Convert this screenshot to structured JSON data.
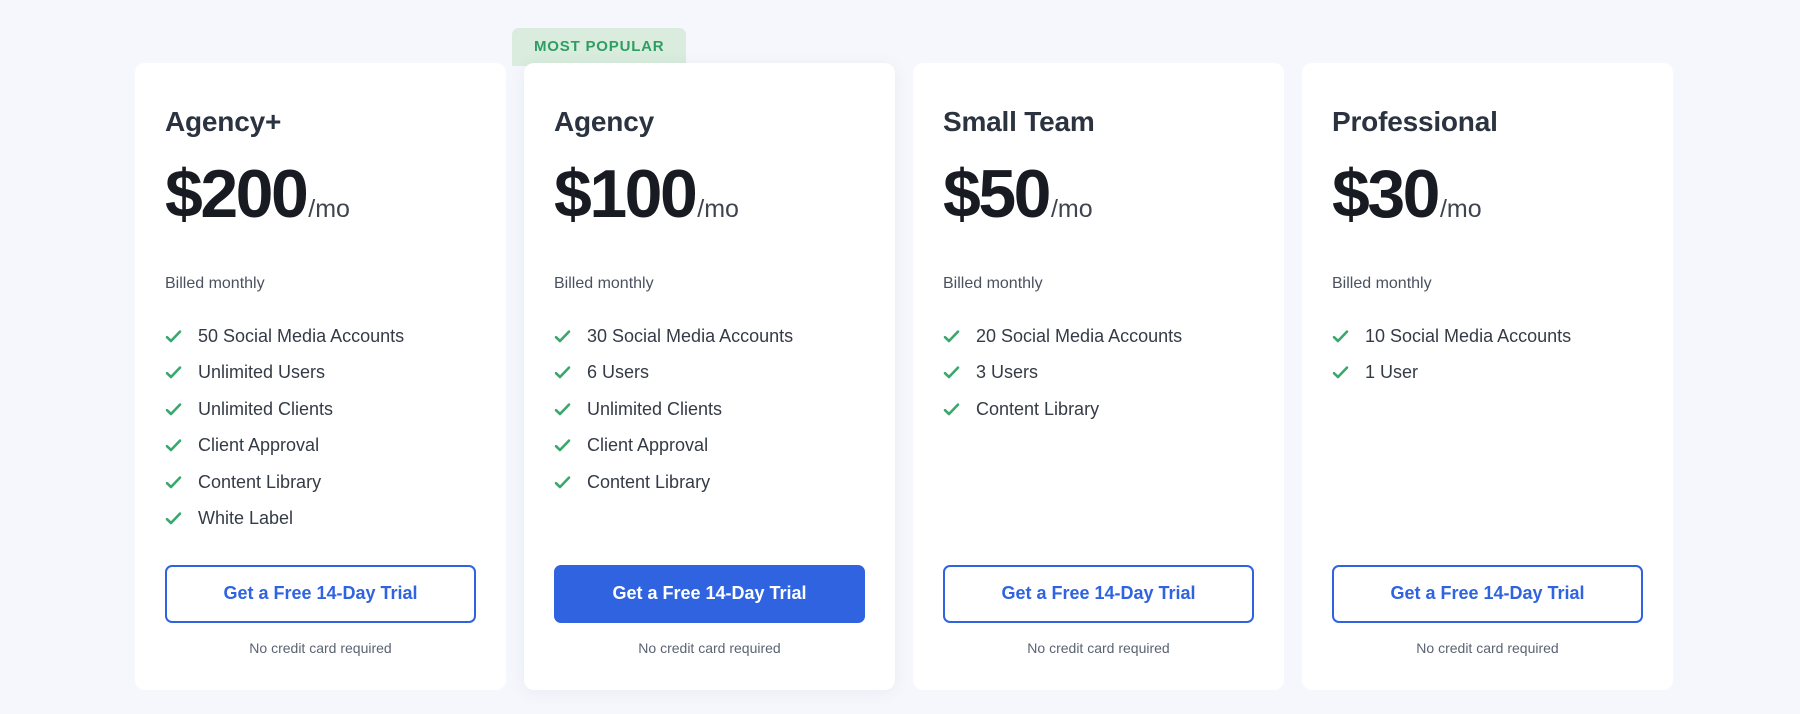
{
  "theme": {
    "page_background": "#f5f7fc",
    "card_background": "#ffffff",
    "accent_blue": "#2f63e0",
    "check_green": "#3aa76d",
    "badge_background": "#d9ecdd",
    "badge_text_color": "#2f9e63"
  },
  "badge": {
    "label": "MOST POPULAR"
  },
  "plans": [
    {
      "name": "Agency+",
      "price": "$200",
      "period": "/mo",
      "billing_note": "Billed monthly",
      "features": [
        "50 Social Media Accounts",
        "Unlimited Users",
        "Unlimited Clients",
        "Client Approval",
        "Content Library",
        "White Label"
      ],
      "cta_label": "Get a Free 14-Day Trial",
      "cta_style": "outline",
      "cta_note": "No credit card required",
      "featured": false
    },
    {
      "name": "Agency",
      "price": "$100",
      "period": "/mo",
      "billing_note": "Billed monthly",
      "features": [
        "30 Social Media Accounts",
        "6 Users",
        "Unlimited Clients",
        "Client Approval",
        "Content Library"
      ],
      "cta_label": "Get a Free 14-Day Trial",
      "cta_style": "filled",
      "cta_note": "No credit card required",
      "featured": true
    },
    {
      "name": "Small Team",
      "price": "$50",
      "period": "/mo",
      "billing_note": "Billed monthly",
      "features": [
        "20 Social Media Accounts",
        "3 Users",
        "Content Library"
      ],
      "cta_label": "Get a Free 14-Day Trial",
      "cta_style": "outline",
      "cta_note": "No credit card required",
      "featured": false
    },
    {
      "name": "Professional",
      "price": "$30",
      "period": "/mo",
      "billing_note": "Billed monthly",
      "features": [
        "10 Social Media Accounts",
        "1 User"
      ],
      "cta_label": "Get a Free 14-Day Trial",
      "cta_style": "outline",
      "cta_note": "No credit card required",
      "featured": false
    }
  ],
  "icons": {
    "check": "check-icon"
  }
}
